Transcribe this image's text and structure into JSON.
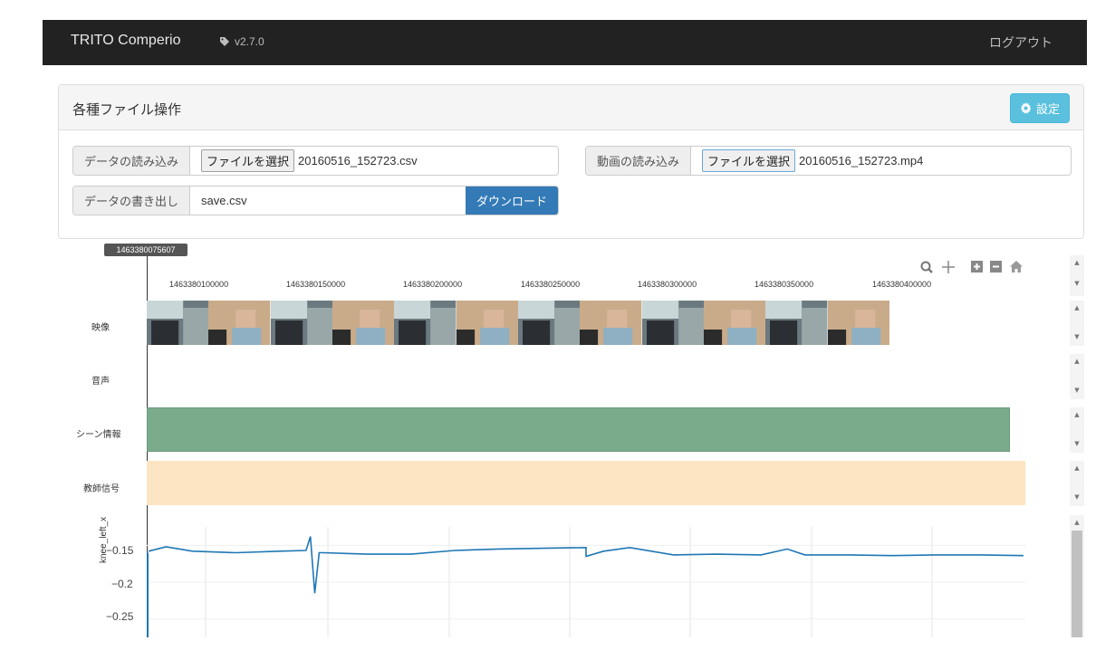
{
  "navbar": {
    "brand": "TRITO Comperio",
    "version": "v2.7.0",
    "logout": "ログアウト"
  },
  "panel": {
    "title": "各種ファイル操作",
    "settings_label": "設定",
    "data_import": {
      "label": "データの読み込み",
      "button": "ファイルを選択",
      "filename": "20160516_152723.csv"
    },
    "video_import": {
      "label": "動画の読み込み",
      "button": "ファイルを選択",
      "filename": "20160516_152723.mp4"
    },
    "data_export": {
      "label": "データの書き出し",
      "value": "save.csv",
      "download_label": "ダウンロード"
    }
  },
  "timeline": {
    "scrubber_time": "1463380075607",
    "timestamps": [
      "1463380100000",
      "1463380150000",
      "1463380200000",
      "1463380250000",
      "1463380300000",
      "1463380350000",
      "1463380400000"
    ],
    "tracks": [
      {
        "label": "映像"
      },
      {
        "label": "音声"
      },
      {
        "label": "シーン情報",
        "color": "#7aab8a"
      },
      {
        "label": "教師信号",
        "color": "#fde4c2"
      }
    ],
    "tools": [
      "zoom-icon",
      "pan-icon",
      "zoom-in-icon",
      "zoom-out-icon",
      "home-icon"
    ]
  },
  "chart_data": {
    "type": "line",
    "title": "",
    "xlabel": "",
    "ylabel": "knee_left_x",
    "yticks": [
      "−0.15",
      "−0.2",
      "−0.25"
    ],
    "ylim": [
      -0.275,
      -0.125
    ],
    "series": [
      {
        "color": "#1f77b4",
        "x": [
          0.0,
          0.02,
          0.05,
          0.1,
          0.15,
          0.18,
          0.185,
          0.19,
          0.195,
          0.2,
          0.25,
          0.3,
          0.35,
          0.4,
          0.45,
          0.5,
          0.5,
          0.52,
          0.55,
          0.6,
          0.65,
          0.7,
          0.73,
          0.75,
          0.8,
          0.85,
          0.9,
          0.95,
          1.0
        ],
        "y": [
          -0.158,
          -0.152,
          -0.158,
          -0.16,
          -0.158,
          -0.157,
          -0.138,
          -0.215,
          -0.16,
          -0.16,
          -0.162,
          -0.162,
          -0.157,
          -0.155,
          -0.154,
          -0.153,
          -0.165,
          -0.158,
          -0.153,
          -0.163,
          -0.162,
          -0.163,
          -0.155,
          -0.163,
          -0.163,
          -0.164,
          -0.163,
          -0.163,
          -0.164
        ]
      }
    ]
  }
}
